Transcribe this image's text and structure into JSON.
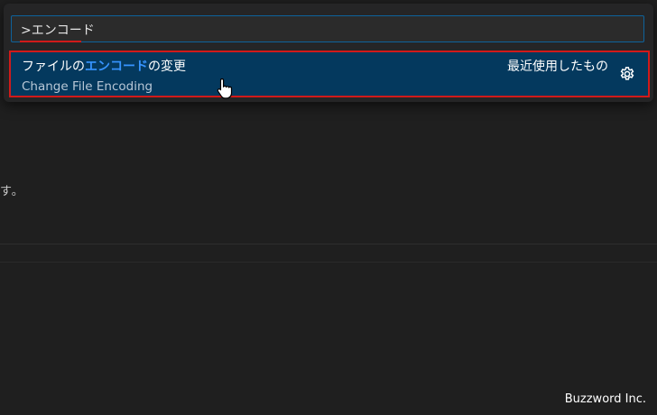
{
  "command_palette": {
    "query": ">エンコード",
    "results": [
      {
        "title_prefix": "ファイルの",
        "title_highlight": "エンコード",
        "title_suffix": "の変更",
        "subtitle": "Change File Encoding",
        "tag": "最近使用したもの",
        "icon": "gear-icon"
      }
    ]
  },
  "editor": {
    "body_fragment": "す。"
  },
  "watermark": "Buzzword Inc.",
  "colors": {
    "background": "#1f1f1f",
    "palette_bg": "#252526",
    "selection_bg": "#04395e",
    "highlight": "#3794ff",
    "annotation_red": "#d11a1a",
    "focus_border": "#0e639c"
  }
}
